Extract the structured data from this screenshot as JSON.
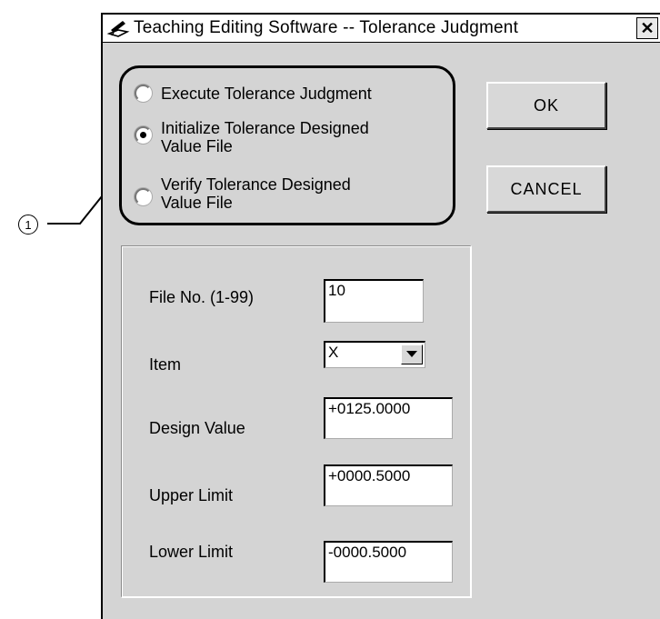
{
  "window": {
    "title": "Teaching Editing Software -- Tolerance Judgment",
    "close_glyph": "✕"
  },
  "callout": {
    "number": "1"
  },
  "radio_options": [
    {
      "label": "Execute Tolerance Judgment",
      "checked": false
    },
    {
      "label": "Initialize Tolerance Designed\nValue File",
      "checked": true
    },
    {
      "label": "Verify Tolerance Designed\nValue File",
      "checked": false
    }
  ],
  "buttons": {
    "ok": "OK",
    "cancel": "CANCEL"
  },
  "form": {
    "file_no": {
      "label": "File No. (1-99)",
      "value": "10"
    },
    "item": {
      "label": "Item",
      "value": "X"
    },
    "design_value": {
      "label": "Design Value",
      "value": "+0125.0000"
    },
    "upper_limit": {
      "label": "Upper Limit",
      "value": "+0000.5000"
    },
    "lower_limit": {
      "label": "Lower Limit",
      "value": "-0000.5000"
    }
  },
  "icons": {
    "app": "pencil-tray-icon",
    "close": "close-icon",
    "dropdown": "triangle-down-icon"
  }
}
